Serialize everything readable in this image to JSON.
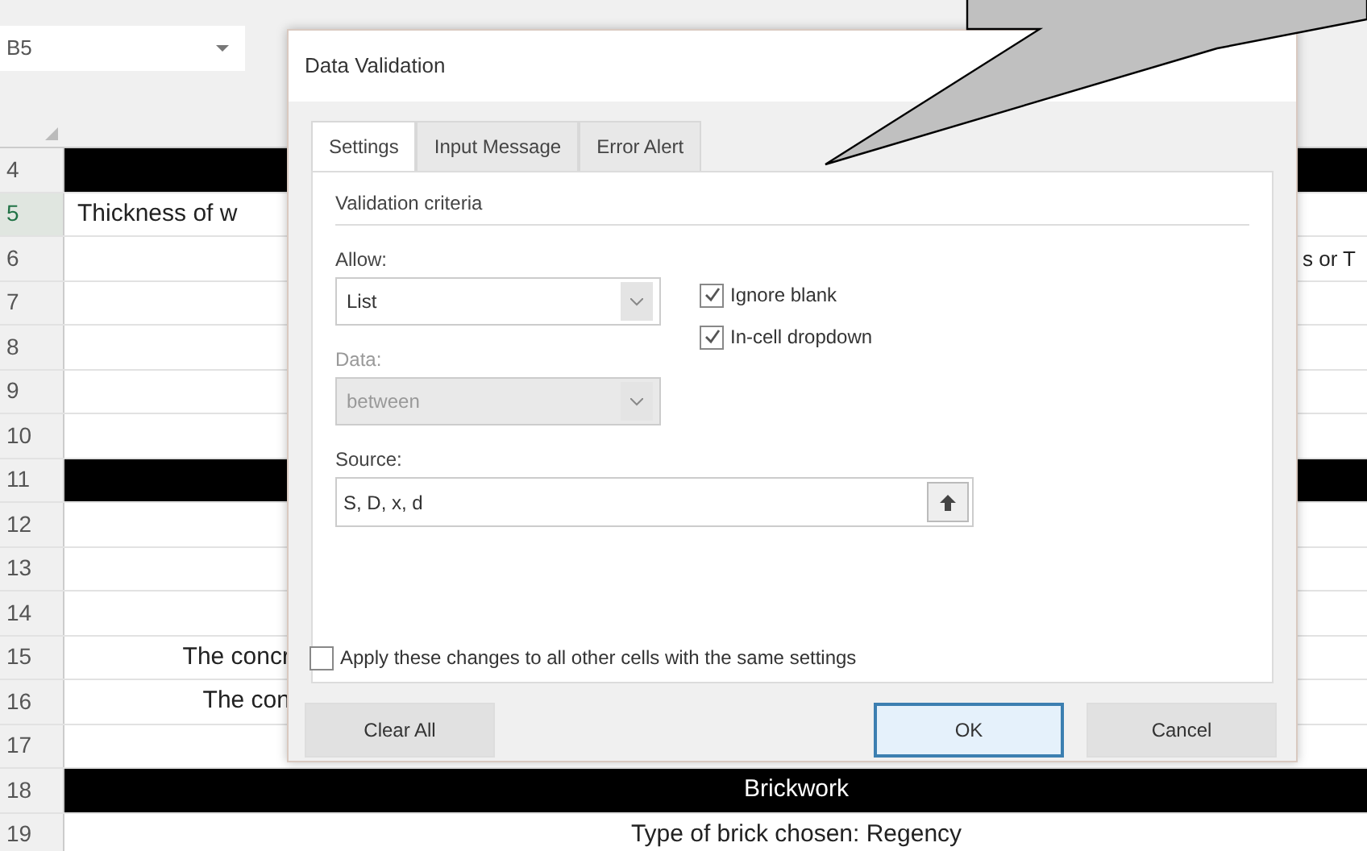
{
  "sheet": {
    "name_box": "B5",
    "rows": [
      {
        "number": "4",
        "kind": "band"
      },
      {
        "number": "5",
        "kind": "plain",
        "selected": true,
        "left": "Thickness of w"
      },
      {
        "number": "6",
        "kind": "plain",
        "right": "s or T"
      },
      {
        "number": "7",
        "kind": "plain"
      },
      {
        "number": "8",
        "kind": "plain"
      },
      {
        "number": "9",
        "kind": "plain"
      },
      {
        "number": "10",
        "kind": "plain"
      },
      {
        "number": "11",
        "kind": "band"
      },
      {
        "number": "12",
        "kind": "plain"
      },
      {
        "number": "13",
        "kind": "plain"
      },
      {
        "number": "14",
        "kind": "plain"
      },
      {
        "number": "15",
        "kind": "plain",
        "left_end": "The concr"
      },
      {
        "number": "16",
        "kind": "plain",
        "left_end": "The con"
      },
      {
        "number": "17",
        "kind": "plain"
      },
      {
        "number": "18",
        "kind": "band",
        "center": "Brickwork"
      },
      {
        "number": "19",
        "kind": "plain",
        "center": "Type of brick chosen: Regency"
      }
    ]
  },
  "dialog": {
    "title": "Data Validation",
    "tabs": [
      {
        "label": "Settings",
        "selected": true
      },
      {
        "label": "Input Message",
        "selected": false
      },
      {
        "label": "Error Alert",
        "selected": false
      }
    ],
    "group_label": "Validation criteria",
    "allow": {
      "label": "Allow:",
      "value": "List",
      "disabled": false
    },
    "data": {
      "label": "Data:",
      "value": "between",
      "disabled": true
    },
    "checkboxes": [
      {
        "label": "Ignore blank",
        "checked": true
      },
      {
        "label": "In-cell dropdown",
        "checked": true
      }
    ],
    "source": {
      "label": "Source:",
      "value": "S, D, x, d"
    },
    "apply_all": {
      "label": "Apply these changes to all other cells with the same settings",
      "checked": false
    },
    "buttons": [
      {
        "label": "Clear All",
        "kind": "plain"
      },
      {
        "label": "OK",
        "kind": "default"
      },
      {
        "label": "Cancel",
        "kind": "plain"
      }
    ]
  }
}
